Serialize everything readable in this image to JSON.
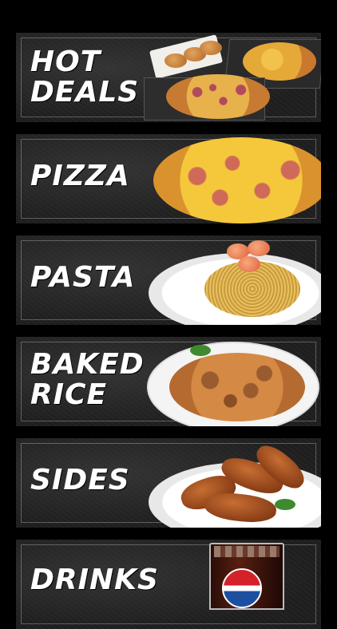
{
  "menu": {
    "items": [
      {
        "lines": [
          "HOT",
          "DEALS"
        ],
        "image": "hot-deals-pizza-boxes"
      },
      {
        "lines": [
          "PIZZA"
        ],
        "image": "pizza-hawaiian"
      },
      {
        "lines": [
          "PASTA"
        ],
        "image": "shrimp-spaghetti"
      },
      {
        "lines": [
          "BAKED",
          "RICE"
        ],
        "image": "baked-rice-dish"
      },
      {
        "lines": [
          "SIDES"
        ],
        "image": "chicken-wings"
      },
      {
        "lines": [
          "DRINKS"
        ],
        "image": "pepsi-glass"
      }
    ]
  },
  "colors": {
    "card_bg": "#1e1e1e",
    "page_bg": "#000000",
    "label_text": "#ffffff",
    "card_border": "#666666"
  }
}
